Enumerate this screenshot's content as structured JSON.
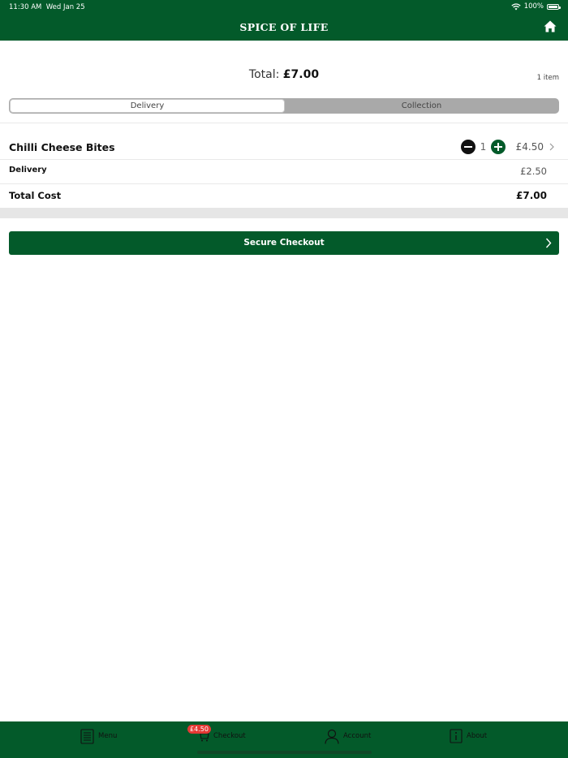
{
  "status_bar": {
    "time": "11:30 AM",
    "date": "Wed Jan 25",
    "battery": "100%"
  },
  "header": {
    "title": "SPICE OF LIFE",
    "home_icon": "home-icon"
  },
  "summary": {
    "total_label": "Total:",
    "total_value": "£7.00",
    "item_count": "1 item"
  },
  "segmented": {
    "options": [
      "Delivery",
      "Collection"
    ],
    "selected": "Delivery"
  },
  "order_item": {
    "name": "Chilli Cheese Bites",
    "quantity": "1",
    "price": "£4.50"
  },
  "delivery": {
    "label": "Delivery",
    "value": "£2.50"
  },
  "total_cost": {
    "label": "Total Cost",
    "value": "£7.00"
  },
  "checkout_button": {
    "label": "Secure Checkout"
  },
  "tabbar": {
    "items": [
      {
        "label": "Menu",
        "icon": "menu-list-icon"
      },
      {
        "label": "Checkout",
        "icon": "cart-icon"
      },
      {
        "label": "Account",
        "icon": "person-icon"
      },
      {
        "label": "About",
        "icon": "info-icon"
      }
    ],
    "checkout_badge": "£4.50"
  },
  "colors": {
    "brand_green": "#035a2a",
    "badge_red": "#e53935",
    "band_grey": "#e6e6e6"
  }
}
